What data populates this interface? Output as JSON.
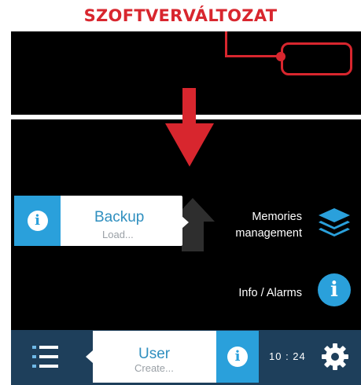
{
  "annotation": {
    "heading": "SZOFTVERVÁLTOZAT",
    "accent_color": "#d8262e"
  },
  "screen": {
    "backup": {
      "title": "Backup",
      "subtitle": "Load...",
      "icon": "info-icon"
    },
    "menu": [
      {
        "label_line1": "Memories",
        "label_line2": "management",
        "icon": "layers-icon"
      },
      {
        "label": "Info / Alarms",
        "icon": "info-icon"
      }
    ],
    "bottom_bar": {
      "menu_icon": "list-icon",
      "user": {
        "title": "User",
        "subtitle": "Create...",
        "icon": "info-icon"
      },
      "clock": "10 : 24",
      "settings_icon": "gear-icon"
    },
    "colors": {
      "accent_blue": "#2aa0db",
      "bar": "#1e3f5b",
      "background": "#000000"
    }
  }
}
